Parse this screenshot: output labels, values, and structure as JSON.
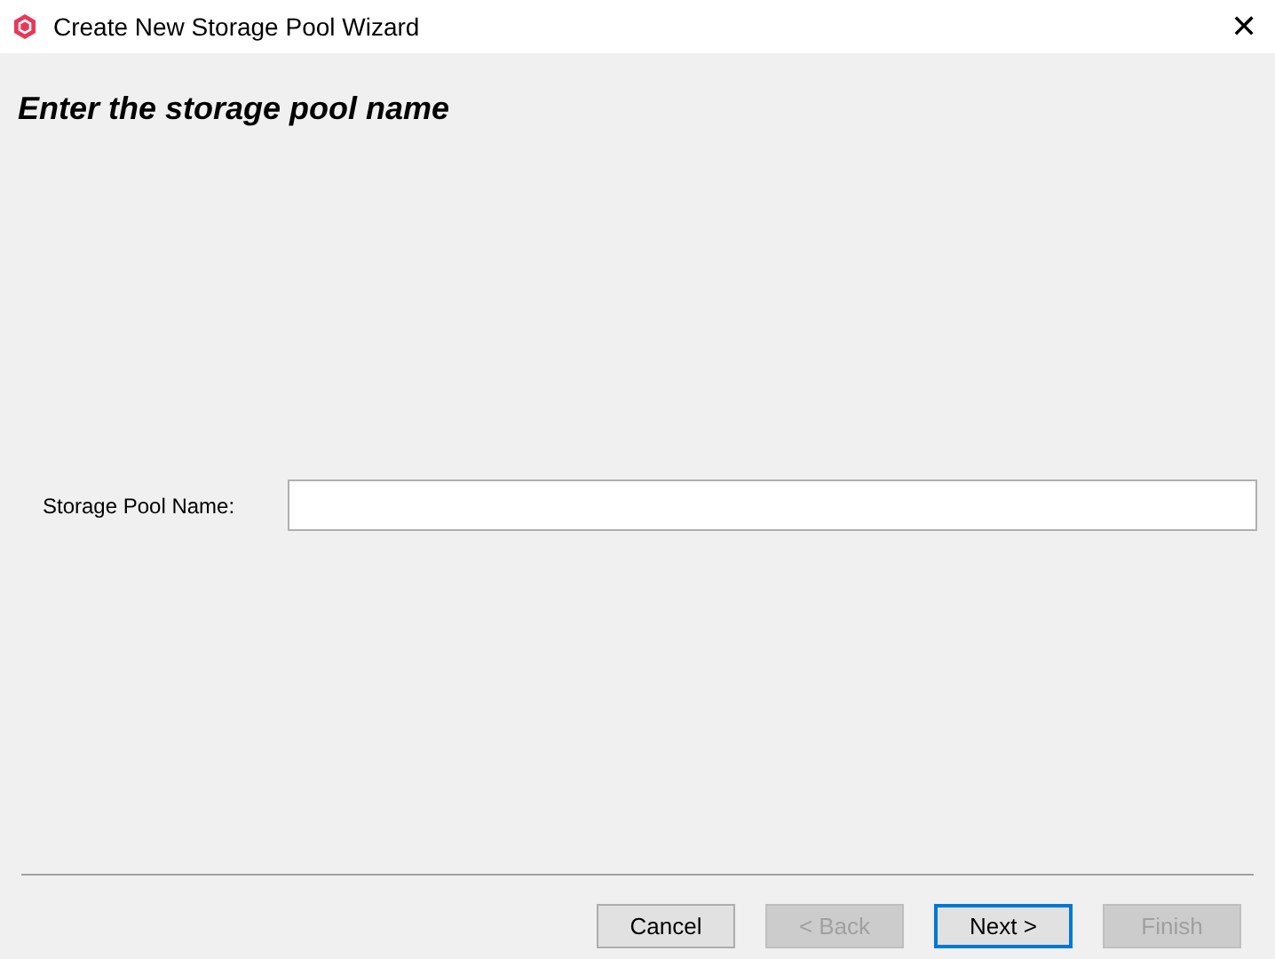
{
  "window": {
    "title": "Create New Storage Pool Wizard",
    "close": "✕"
  },
  "heading": "Enter the storage pool name",
  "field": {
    "label": "Storage Pool Name:"
  },
  "buttons": [
    {
      "label": "Cancel",
      "disabled": false,
      "default": false
    },
    {
      "label": "< Back",
      "disabled": true,
      "default": false
    },
    {
      "label": "Next >",
      "disabled": false,
      "default": true
    },
    {
      "label": "Finish",
      "disabled": true,
      "default": false
    }
  ]
}
